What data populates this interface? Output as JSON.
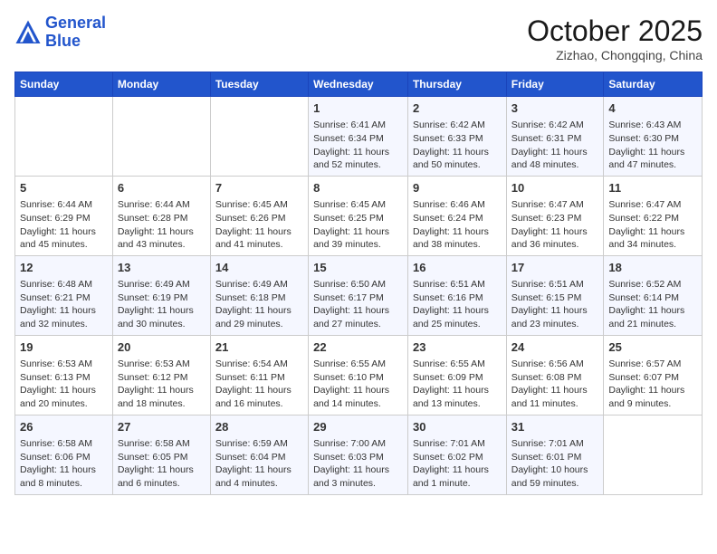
{
  "header": {
    "logo_line1": "General",
    "logo_line2": "Blue",
    "month": "October 2025",
    "location": "Zizhao, Chongqing, China"
  },
  "days_of_week": [
    "Sunday",
    "Monday",
    "Tuesday",
    "Wednesday",
    "Thursday",
    "Friday",
    "Saturday"
  ],
  "weeks": [
    [
      {
        "day": "",
        "info": ""
      },
      {
        "day": "",
        "info": ""
      },
      {
        "day": "",
        "info": ""
      },
      {
        "day": "1",
        "info": "Sunrise: 6:41 AM\nSunset: 6:34 PM\nDaylight: 11 hours and 52 minutes."
      },
      {
        "day": "2",
        "info": "Sunrise: 6:42 AM\nSunset: 6:33 PM\nDaylight: 11 hours and 50 minutes."
      },
      {
        "day": "3",
        "info": "Sunrise: 6:42 AM\nSunset: 6:31 PM\nDaylight: 11 hours and 48 minutes."
      },
      {
        "day": "4",
        "info": "Sunrise: 6:43 AM\nSunset: 6:30 PM\nDaylight: 11 hours and 47 minutes."
      }
    ],
    [
      {
        "day": "5",
        "info": "Sunrise: 6:44 AM\nSunset: 6:29 PM\nDaylight: 11 hours and 45 minutes."
      },
      {
        "day": "6",
        "info": "Sunrise: 6:44 AM\nSunset: 6:28 PM\nDaylight: 11 hours and 43 minutes."
      },
      {
        "day": "7",
        "info": "Sunrise: 6:45 AM\nSunset: 6:26 PM\nDaylight: 11 hours and 41 minutes."
      },
      {
        "day": "8",
        "info": "Sunrise: 6:45 AM\nSunset: 6:25 PM\nDaylight: 11 hours and 39 minutes."
      },
      {
        "day": "9",
        "info": "Sunrise: 6:46 AM\nSunset: 6:24 PM\nDaylight: 11 hours and 38 minutes."
      },
      {
        "day": "10",
        "info": "Sunrise: 6:47 AM\nSunset: 6:23 PM\nDaylight: 11 hours and 36 minutes."
      },
      {
        "day": "11",
        "info": "Sunrise: 6:47 AM\nSunset: 6:22 PM\nDaylight: 11 hours and 34 minutes."
      }
    ],
    [
      {
        "day": "12",
        "info": "Sunrise: 6:48 AM\nSunset: 6:21 PM\nDaylight: 11 hours and 32 minutes."
      },
      {
        "day": "13",
        "info": "Sunrise: 6:49 AM\nSunset: 6:19 PM\nDaylight: 11 hours and 30 minutes."
      },
      {
        "day": "14",
        "info": "Sunrise: 6:49 AM\nSunset: 6:18 PM\nDaylight: 11 hours and 29 minutes."
      },
      {
        "day": "15",
        "info": "Sunrise: 6:50 AM\nSunset: 6:17 PM\nDaylight: 11 hours and 27 minutes."
      },
      {
        "day": "16",
        "info": "Sunrise: 6:51 AM\nSunset: 6:16 PM\nDaylight: 11 hours and 25 minutes."
      },
      {
        "day": "17",
        "info": "Sunrise: 6:51 AM\nSunset: 6:15 PM\nDaylight: 11 hours and 23 minutes."
      },
      {
        "day": "18",
        "info": "Sunrise: 6:52 AM\nSunset: 6:14 PM\nDaylight: 11 hours and 21 minutes."
      }
    ],
    [
      {
        "day": "19",
        "info": "Sunrise: 6:53 AM\nSunset: 6:13 PM\nDaylight: 11 hours and 20 minutes."
      },
      {
        "day": "20",
        "info": "Sunrise: 6:53 AM\nSunset: 6:12 PM\nDaylight: 11 hours and 18 minutes."
      },
      {
        "day": "21",
        "info": "Sunrise: 6:54 AM\nSunset: 6:11 PM\nDaylight: 11 hours and 16 minutes."
      },
      {
        "day": "22",
        "info": "Sunrise: 6:55 AM\nSunset: 6:10 PM\nDaylight: 11 hours and 14 minutes."
      },
      {
        "day": "23",
        "info": "Sunrise: 6:55 AM\nSunset: 6:09 PM\nDaylight: 11 hours and 13 minutes."
      },
      {
        "day": "24",
        "info": "Sunrise: 6:56 AM\nSunset: 6:08 PM\nDaylight: 11 hours and 11 minutes."
      },
      {
        "day": "25",
        "info": "Sunrise: 6:57 AM\nSunset: 6:07 PM\nDaylight: 11 hours and 9 minutes."
      }
    ],
    [
      {
        "day": "26",
        "info": "Sunrise: 6:58 AM\nSunset: 6:06 PM\nDaylight: 11 hours and 8 minutes."
      },
      {
        "day": "27",
        "info": "Sunrise: 6:58 AM\nSunset: 6:05 PM\nDaylight: 11 hours and 6 minutes."
      },
      {
        "day": "28",
        "info": "Sunrise: 6:59 AM\nSunset: 6:04 PM\nDaylight: 11 hours and 4 minutes."
      },
      {
        "day": "29",
        "info": "Sunrise: 7:00 AM\nSunset: 6:03 PM\nDaylight: 11 hours and 3 minutes."
      },
      {
        "day": "30",
        "info": "Sunrise: 7:01 AM\nSunset: 6:02 PM\nDaylight: 11 hours and 1 minute."
      },
      {
        "day": "31",
        "info": "Sunrise: 7:01 AM\nSunset: 6:01 PM\nDaylight: 10 hours and 59 minutes."
      },
      {
        "day": "",
        "info": ""
      }
    ]
  ]
}
